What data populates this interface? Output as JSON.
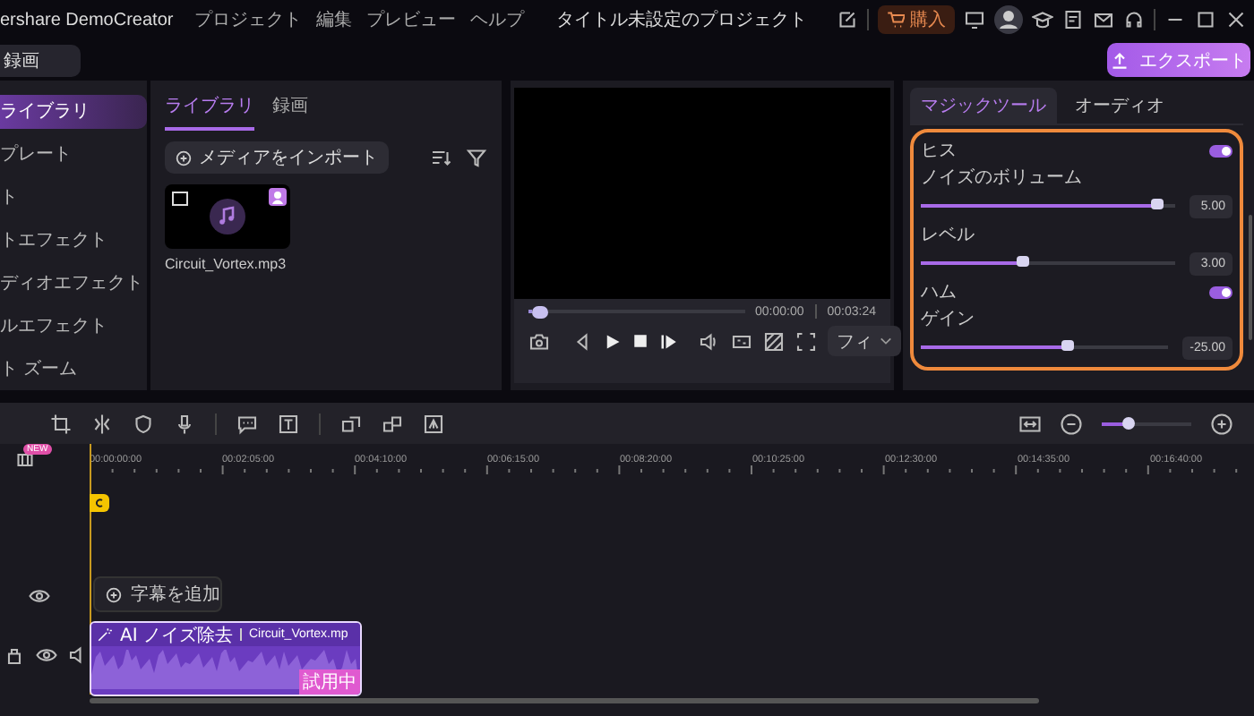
{
  "app": {
    "name": "ershare DemoCreator",
    "menus": [
      "プロジェクト",
      "編集",
      "プレビュー",
      "ヘルプ"
    ],
    "title": "タイトル未設定のプロジェクト",
    "buy": "購入"
  },
  "record_button": "録画",
  "export_button": "エクスポート",
  "sidebar": {
    "items": [
      {
        "label": "ライブラリ",
        "selected": true
      },
      {
        "label": "プレート",
        "selected": false
      },
      {
        "label": "ト",
        "selected": false
      },
      {
        "label": "トエフェクト",
        "selected": false
      },
      {
        "label": "ディオエフェクト",
        "selected": false
      },
      {
        "label": "ルエフェクト",
        "selected": false
      },
      {
        "label": "ト ズーム",
        "selected": false
      }
    ]
  },
  "media": {
    "tabs": [
      {
        "label": "ライブラリ",
        "selected": true
      },
      {
        "label": "録画",
        "selected": false
      }
    ],
    "import": "メディアをインポート",
    "files": [
      {
        "name": "Circuit_Vortex.mp3"
      }
    ]
  },
  "preview": {
    "level": 0.02,
    "current": "00:00:00",
    "total": "00:03:24",
    "fit": "フィ"
  },
  "panel": {
    "tabs": [
      {
        "label": "マジックツール",
        "selected": true
      },
      {
        "label": "オーディオ",
        "selected": false
      }
    ],
    "controls": [
      {
        "kind": "toggle",
        "label": "ヒス",
        "on": true
      },
      {
        "kind": "slider",
        "label": "ノイズのボリューム",
        "level": 0.93,
        "value": "5.00"
      },
      {
        "kind": "slider",
        "label": "レベル",
        "level": 0.4,
        "value": "3.00"
      },
      {
        "kind": "toggle",
        "label": "ハム",
        "on": true
      },
      {
        "kind": "slider",
        "label": "ゲイン",
        "level": 0.59,
        "value": "-25.00"
      }
    ]
  },
  "timeline": {
    "zoom": {
      "level": 0.3
    },
    "new_badge": "NEW",
    "ruler": [
      "00:00:00:00",
      "00:02:05:00",
      "00:04:10:00",
      "00:06:15:00",
      "00:08:20:00",
      "00:10:25:00",
      "00:12:30:00",
      "00:14:35:00",
      "00:16:40:00"
    ],
    "caption_button": "字幕を追加",
    "clip": {
      "effect": "AI ノイズ除去",
      "name": "Circuit_Vortex.mp",
      "badge": "試用中"
    }
  }
}
